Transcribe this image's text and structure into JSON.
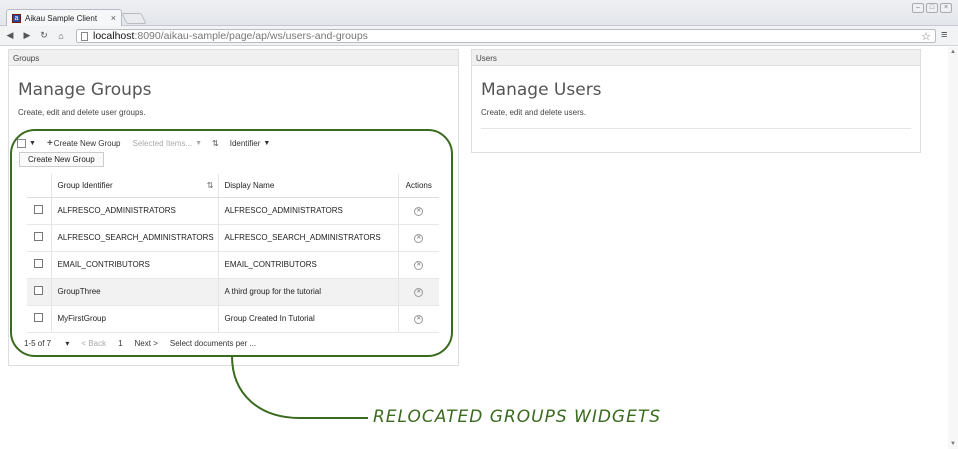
{
  "browser": {
    "tab_title": "Aikau Sample Client",
    "url_host": "localhost",
    "url_path": ":8090/aikau-sample/page/ap/ws/users-and-groups"
  },
  "groups_panel": {
    "header": "Groups",
    "title": "Manage Groups",
    "subtitle": "Create, edit and delete user groups.",
    "toolbar": {
      "create_label": "Create New Group",
      "selected_items": "Selected Items...",
      "sort_field": "Identifier"
    },
    "create_button": "Create New Group",
    "columns": [
      "Group Identifier",
      "Display Name",
      "Actions"
    ],
    "rows": [
      {
        "id": "ALFRESCO_ADMINISTRATORS",
        "name": "ALFRESCO_ADMINISTRATORS"
      },
      {
        "id": "ALFRESCO_SEARCH_ADMINISTRATORS",
        "name": "ALFRESCO_SEARCH_ADMINISTRATORS"
      },
      {
        "id": "EMAIL_CONTRIBUTORS",
        "name": "EMAIL_CONTRIBUTORS"
      },
      {
        "id": "GroupThree",
        "name": "A third group for the tutorial"
      },
      {
        "id": "MyFirstGroup",
        "name": "Group Created In Tutorial"
      }
    ],
    "pager": {
      "range": "1-5 of 7",
      "back": "< Back",
      "page": "1",
      "next": "Next >",
      "per_page": "Select documents per ..."
    }
  },
  "users_panel": {
    "header": "Users",
    "title": "Manage Users",
    "subtitle": "Create, edit and delete users."
  },
  "annotation": {
    "label": "RELOCATED GROUPS WIDGETS",
    "color": "#3a6b1f"
  },
  "icons": {
    "close": "close-icon",
    "back": "back-arrow-icon",
    "forward": "forward-arrow-icon",
    "reload": "reload-icon",
    "home": "home-icon",
    "bookmark": "star-icon",
    "menu": "menu-icon",
    "delete": "delete-icon",
    "sort": "sort-icon"
  }
}
